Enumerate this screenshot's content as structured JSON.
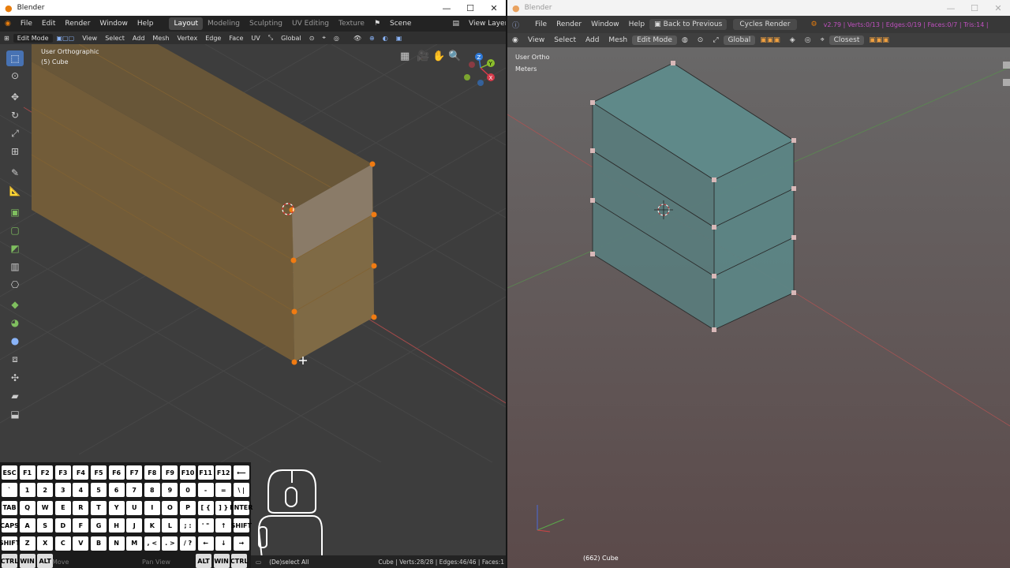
{
  "left": {
    "title": "Blender",
    "win_buttons": [
      "—",
      "☐",
      "✕"
    ],
    "menu": [
      "File",
      "Edit",
      "Render",
      "Window",
      "Help"
    ],
    "workspaces": [
      "Layout",
      "Modeling",
      "Sculpting",
      "UV Editing",
      "Texture"
    ],
    "active_workspace": "Layout",
    "scene": "Scene",
    "view_layer": "View Layer",
    "header": {
      "mode": "Edit Mode",
      "menus": [
        "View",
        "Select",
        "Add",
        "Mesh",
        "Vertex",
        "Edge",
        "Face",
        "UV"
      ],
      "orientation": "Global"
    },
    "overlay": {
      "view": "User Orthographic",
      "object": "(5) Cube"
    },
    "gizmo": {
      "x": "X",
      "y": "Y",
      "z": "Z"
    },
    "status": {
      "move": "Move",
      "pan": "Pan View",
      "deselect": "(De)select All",
      "stats": "Cube | Verts:28/28 | Edges:46/46 | Faces:1"
    }
  },
  "keyboard": {
    "row1": [
      "ESC",
      "F1",
      "F2",
      "F3",
      "F4",
      "F5",
      "F6",
      "F7",
      "F8",
      "F9",
      "F10",
      "F11",
      "F12",
      "⟵"
    ],
    "row2": [
      "`",
      "1",
      "2",
      "3",
      "4",
      "5",
      "6",
      "7",
      "8",
      "9",
      "0",
      "-",
      "=",
      "\\ |"
    ],
    "row3": [
      "TAB",
      "Q",
      "W",
      "E",
      "R",
      "T",
      "Y",
      "U",
      "I",
      "O",
      "P",
      "[ {",
      "] }",
      "ENTER"
    ],
    "row4": [
      "CAPS",
      "A",
      "S",
      "D",
      "F",
      "G",
      "H",
      "J",
      "K",
      "L",
      "; :",
      "' \"",
      "↑",
      "SHIFT"
    ],
    "row5": [
      "SHIFT",
      "Z",
      "X",
      "C",
      "V",
      "B",
      "N",
      "M",
      ", <",
      ". >",
      "/ ?",
      "←",
      "↓",
      "→"
    ],
    "row6": [
      "CTRL",
      "WIN",
      "ALT",
      "ALT",
      "WIN",
      "CTRL"
    ]
  },
  "right": {
    "title": "Blender",
    "win_buttons": [
      "—",
      "☐",
      "✕"
    ],
    "menu": [
      "File",
      "Render",
      "Window",
      "Help"
    ],
    "back": "Back to Previous",
    "engine": "Cycles Render",
    "stats": "v2.79 | Verts:0/13 | Edges:0/19 | Faces:0/7 | Tris:14 |",
    "header": {
      "menus": [
        "View",
        "Select",
        "Add",
        "Mesh"
      ],
      "mode": "Edit Mode",
      "orientation": "Global",
      "snap": "Closest"
    },
    "overlay": {
      "view": "User Ortho",
      "units": "Meters",
      "object": "(662) Cube"
    }
  },
  "colors": {
    "accent": "#4772b3",
    "vertex_left": "#f07b12",
    "stats_purple": "#c050c0"
  }
}
